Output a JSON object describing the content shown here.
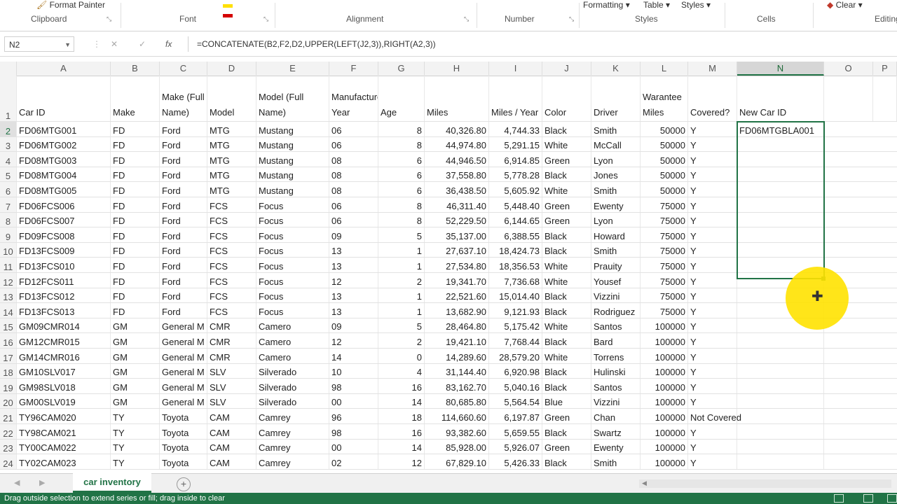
{
  "ribbon": {
    "format_painter": "Format Painter",
    "groups": [
      "Clipboard",
      "Font",
      "Alignment",
      "Number",
      "Styles",
      "Cells",
      "Editing"
    ],
    "styles_items": [
      "Formatting",
      "Table",
      "Styles"
    ],
    "clear_label": "Clear"
  },
  "formula_bar": {
    "name_box": "N2",
    "fx": "fx",
    "formula": "=CONCATENATE(B2,F2,D2,UPPER(LEFT(J2,3)),RIGHT(A2,3))"
  },
  "columns": [
    "A",
    "B",
    "C",
    "D",
    "E",
    "F",
    "G",
    "H",
    "I",
    "J",
    "K",
    "L",
    "M",
    "N",
    "O",
    "P"
  ],
  "header_row": {
    "num": "1",
    "cells": [
      "Car ID",
      "Make",
      "Make (Full Name)",
      "Model",
      "Model (Full Name)",
      "Manufacture Year",
      "Age",
      "Miles",
      "Miles / Year",
      "Color",
      "Driver",
      "Warantee Miles",
      "Covered?",
      "New Car ID",
      "",
      ""
    ]
  },
  "rows": [
    {
      "num": "2",
      "cells": [
        "FD06MTG001",
        "FD",
        "Ford",
        "MTG",
        "Mustang",
        "06",
        "8",
        "40,326.80",
        "4,744.33",
        "Black",
        "Smith",
        "50000",
        "Y",
        "FD06MTGBLA001"
      ]
    },
    {
      "num": "3",
      "cells": [
        "FD06MTG002",
        "FD",
        "Ford",
        "MTG",
        "Mustang",
        "06",
        "8",
        "44,974.80",
        "5,291.15",
        "White",
        "McCall",
        "50000",
        "Y",
        ""
      ]
    },
    {
      "num": "4",
      "cells": [
        "FD08MTG003",
        "FD",
        "Ford",
        "MTG",
        "Mustang",
        "08",
        "6",
        "44,946.50",
        "6,914.85",
        "Green",
        "Lyon",
        "50000",
        "Y",
        ""
      ]
    },
    {
      "num": "5",
      "cells": [
        "FD08MTG004",
        "FD",
        "Ford",
        "MTG",
        "Mustang",
        "08",
        "6",
        "37,558.80",
        "5,778.28",
        "Black",
        "Jones",
        "50000",
        "Y",
        ""
      ]
    },
    {
      "num": "6",
      "cells": [
        "FD08MTG005",
        "FD",
        "Ford",
        "MTG",
        "Mustang",
        "08",
        "6",
        "36,438.50",
        "5,605.92",
        "White",
        "Smith",
        "50000",
        "Y",
        ""
      ]
    },
    {
      "num": "7",
      "cells": [
        "FD06FCS006",
        "FD",
        "Ford",
        "FCS",
        "Focus",
        "06",
        "8",
        "46,311.40",
        "5,448.40",
        "Green",
        "Ewenty",
        "75000",
        "Y",
        ""
      ]
    },
    {
      "num": "8",
      "cells": [
        "FD06FCS007",
        "FD",
        "Ford",
        "FCS",
        "Focus",
        "06",
        "8",
        "52,229.50",
        "6,144.65",
        "Green",
        "Lyon",
        "75000",
        "Y",
        ""
      ]
    },
    {
      "num": "9",
      "cells": [
        "FD09FCS008",
        "FD",
        "Ford",
        "FCS",
        "Focus",
        "09",
        "5",
        "35,137.00",
        "6,388.55",
        "Black",
        "Howard",
        "75000",
        "Y",
        ""
      ]
    },
    {
      "num": "10",
      "cells": [
        "FD13FCS009",
        "FD",
        "Ford",
        "FCS",
        "Focus",
        "13",
        "1",
        "27,637.10",
        "18,424.73",
        "Black",
        "Smith",
        "75000",
        "Y",
        ""
      ]
    },
    {
      "num": "11",
      "cells": [
        "FD13FCS010",
        "FD",
        "Ford",
        "FCS",
        "Focus",
        "13",
        "1",
        "27,534.80",
        "18,356.53",
        "White",
        "Prauity",
        "75000",
        "Y",
        ""
      ]
    },
    {
      "num": "12",
      "cells": [
        "FD12FCS011",
        "FD",
        "Ford",
        "FCS",
        "Focus",
        "12",
        "2",
        "19,341.70",
        "7,736.68",
        "White",
        "Yousef",
        "75000",
        "Y",
        ""
      ]
    },
    {
      "num": "13",
      "cells": [
        "FD13FCS012",
        "FD",
        "Ford",
        "FCS",
        "Focus",
        "13",
        "1",
        "22,521.60",
        "15,014.40",
        "Black",
        "Vizzini",
        "75000",
        "Y",
        ""
      ]
    },
    {
      "num": "14",
      "cells": [
        "FD13FCS013",
        "FD",
        "Ford",
        "FCS",
        "Focus",
        "13",
        "1",
        "13,682.90",
        "9,121.93",
        "Black",
        "Rodriguez",
        "75000",
        "Y",
        ""
      ]
    },
    {
      "num": "15",
      "cells": [
        "GM09CMR014",
        "GM",
        "General M",
        "CMR",
        "Camero",
        "09",
        "5",
        "28,464.80",
        "5,175.42",
        "White",
        "Santos",
        "100000",
        "Y",
        ""
      ]
    },
    {
      "num": "16",
      "cells": [
        "GM12CMR015",
        "GM",
        "General M",
        "CMR",
        "Camero",
        "12",
        "2",
        "19,421.10",
        "7,768.44",
        "Black",
        "Bard",
        "100000",
        "Y",
        ""
      ]
    },
    {
      "num": "17",
      "cells": [
        "GM14CMR016",
        "GM",
        "General M",
        "CMR",
        "Camero",
        "14",
        "0",
        "14,289.60",
        "28,579.20",
        "White",
        "Torrens",
        "100000",
        "Y",
        ""
      ]
    },
    {
      "num": "18",
      "cells": [
        "GM10SLV017",
        "GM",
        "General M",
        "SLV",
        "Silverado",
        "10",
        "4",
        "31,144.40",
        "6,920.98",
        "Black",
        "Hulinski",
        "100000",
        "Y",
        ""
      ]
    },
    {
      "num": "19",
      "cells": [
        "GM98SLV018",
        "GM",
        "General M",
        "SLV",
        "Silverado",
        "98",
        "16",
        "83,162.70",
        "5,040.16",
        "Black",
        "Santos",
        "100000",
        "Y",
        ""
      ]
    },
    {
      "num": "20",
      "cells": [
        "GM00SLV019",
        "GM",
        "General M",
        "SLV",
        "Silverado",
        "00",
        "14",
        "80,685.80",
        "5,564.54",
        "Blue",
        "Vizzini",
        "100000",
        "Y",
        ""
      ]
    },
    {
      "num": "21",
      "cells": [
        "TY96CAM020",
        "TY",
        "Toyota",
        "CAM",
        "Camrey",
        "96",
        "18",
        "114,660.60",
        "6,197.87",
        "Green",
        "Chan",
        "100000",
        "Not Covered",
        ""
      ]
    },
    {
      "num": "22",
      "cells": [
        "TY98CAM021",
        "TY",
        "Toyota",
        "CAM",
        "Camrey",
        "98",
        "16",
        "93,382.60",
        "5,659.55",
        "Black",
        "Swartz",
        "100000",
        "Y",
        ""
      ]
    },
    {
      "num": "23",
      "cells": [
        "TY00CAM022",
        "TY",
        "Toyota",
        "CAM",
        "Camrey",
        "00",
        "14",
        "85,928.00",
        "5,926.07",
        "Green",
        "Ewenty",
        "100000",
        "Y",
        ""
      ]
    },
    {
      "num": "24",
      "cells": [
        "TY02CAM023",
        "TY",
        "Toyota",
        "CAM",
        "Camrey",
        "02",
        "12",
        "67,829.10",
        "5,426.33",
        "Black",
        "Smith",
        "100000",
        "Y",
        ""
      ]
    }
  ],
  "sheet_tab": "car inventory",
  "add_sheet": "+",
  "status_bar": "Drag outside selection to extend series or fill; drag inside to clear",
  "colors": {
    "accent": "#217346",
    "highlight": "#ffe200"
  }
}
